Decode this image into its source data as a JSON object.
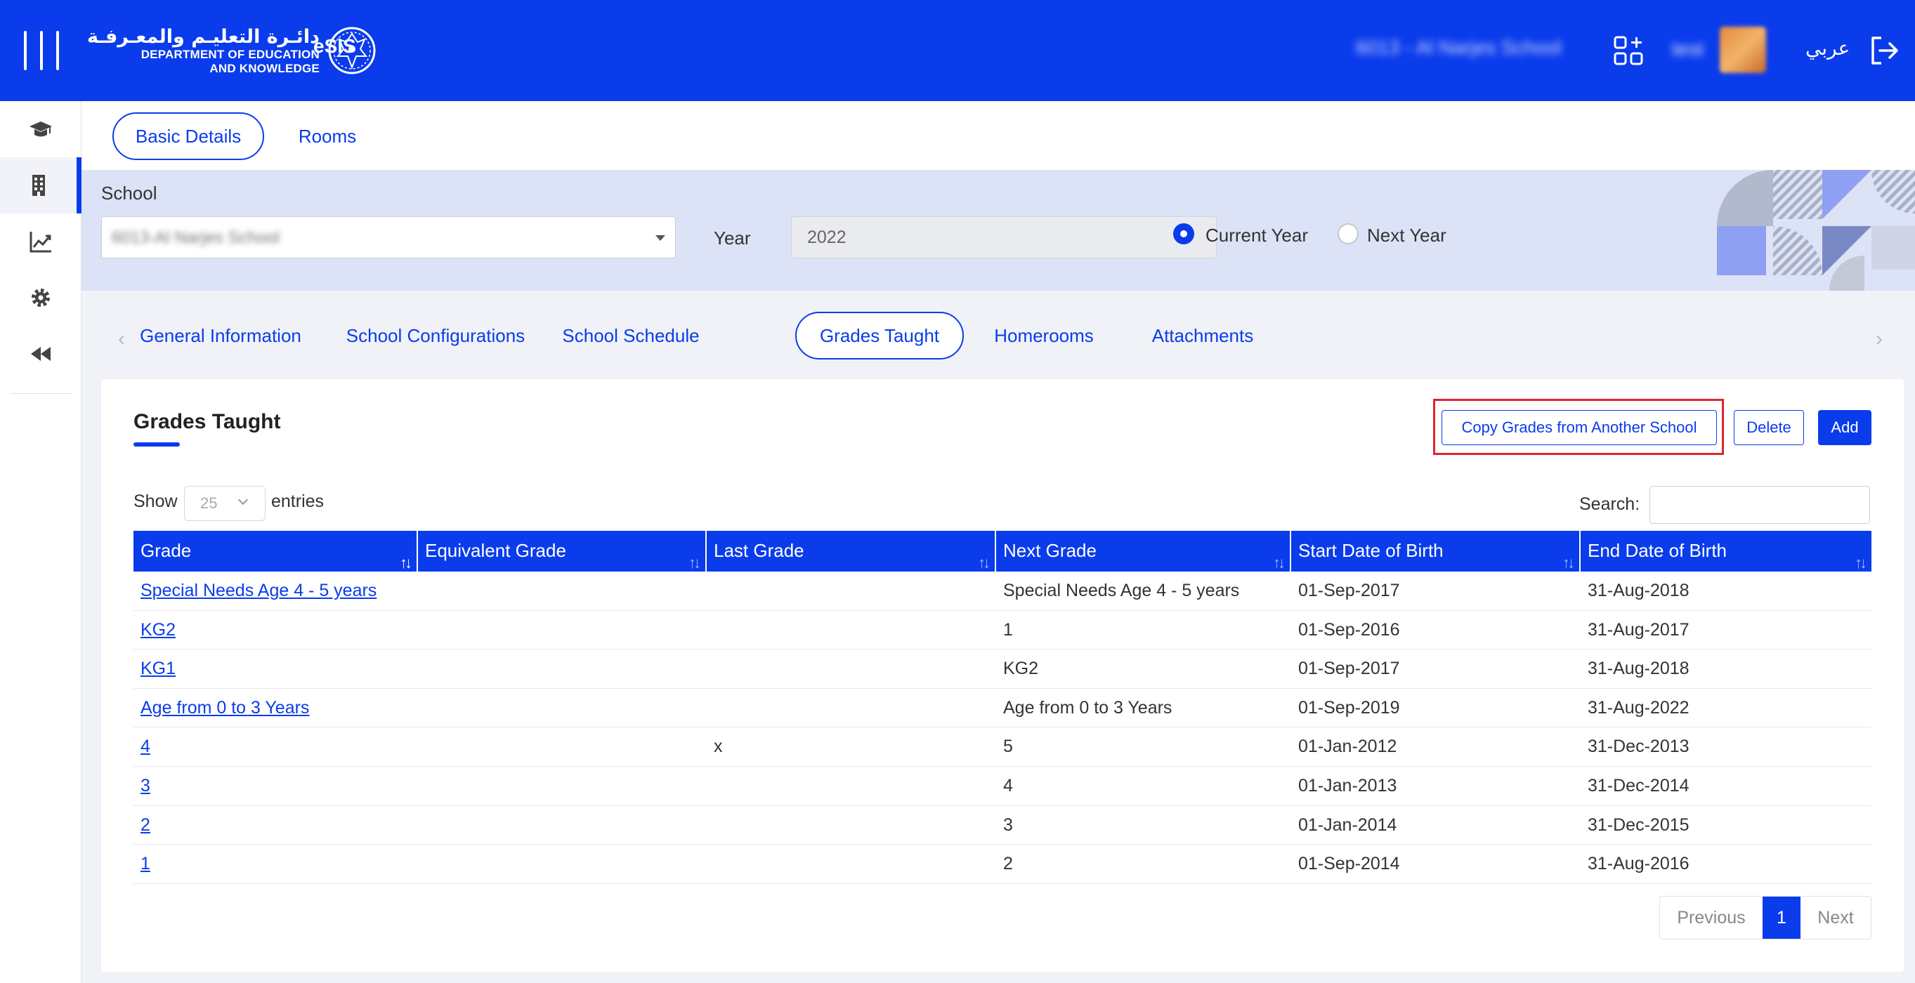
{
  "header": {
    "org_name_ar": "دائـرة التعليـم والمعـرفـة",
    "org_name_en_line1": "DEPARTMENT OF EDUCATION",
    "org_name_en_line2": "AND KNOWLEDGE",
    "app_name": "eSIS",
    "current_school": "6013 - Al Narjes School",
    "user_name": "test",
    "language_toggle": "عربي",
    "brand_color": "#0a3cec"
  },
  "sidebar": {
    "items": [
      {
        "icon": "graduation-cap-icon"
      },
      {
        "icon": "building-icon",
        "active": true
      },
      {
        "icon": "chart-line-icon"
      },
      {
        "icon": "gear-icon"
      },
      {
        "icon": "rewind-icon"
      }
    ]
  },
  "page_tabs": [
    {
      "label": "Basic Details",
      "active": true
    },
    {
      "label": "Rooms",
      "active": false
    }
  ],
  "filters": {
    "school_label": "School",
    "school_value": "6013-Al Narjes School",
    "year_label": "Year",
    "year_value": "2022",
    "radio_current": "Current Year",
    "radio_next": "Next Year",
    "selected_radio": "current"
  },
  "section_tabs": [
    {
      "label": "General Information",
      "active": false
    },
    {
      "label": "School Configurations",
      "active": false
    },
    {
      "label": "School Schedule",
      "active": false
    },
    {
      "label": "Grades Taught",
      "active": true
    },
    {
      "label": "Homerooms",
      "active": false
    },
    {
      "label": "Attachments",
      "active": false
    }
  ],
  "card": {
    "title": "Grades Taught",
    "copy_button": "Copy Grades from Another School",
    "delete_button": "Delete",
    "add_button": "Add",
    "show_label": "Show",
    "entries_value": "25",
    "entries_label": "entries",
    "search_label": "Search:"
  },
  "table": {
    "columns": [
      "Grade",
      "Equivalent Grade",
      "Last Grade",
      "Next Grade",
      "Start Date of Birth",
      "End Date of Birth"
    ],
    "rows": [
      [
        "Special Needs Age 4 - 5 years",
        "",
        "",
        "Special Needs Age 4 - 5 years",
        "01-Sep-2017",
        "31-Aug-2018"
      ],
      [
        "KG2",
        "",
        "",
        "1",
        "01-Sep-2016",
        "31-Aug-2017"
      ],
      [
        "KG1",
        "",
        "",
        "KG2",
        "01-Sep-2017",
        "31-Aug-2018"
      ],
      [
        "Age from 0 to 3 Years",
        "",
        "",
        "Age from 0 to 3 Years",
        "01-Sep-2019",
        "31-Aug-2022"
      ],
      [
        "4",
        "",
        "x",
        "5",
        "01-Jan-2012",
        "31-Dec-2013"
      ],
      [
        "3",
        "",
        "",
        "4",
        "01-Jan-2013",
        "31-Dec-2014"
      ],
      [
        "2",
        "",
        "",
        "3",
        "01-Jan-2014",
        "31-Dec-2015"
      ],
      [
        "1",
        "",
        "",
        "2",
        "01-Sep-2014",
        "31-Aug-2016"
      ]
    ]
  },
  "pagination": {
    "previous": "Previous",
    "current": "1",
    "next": "Next"
  }
}
